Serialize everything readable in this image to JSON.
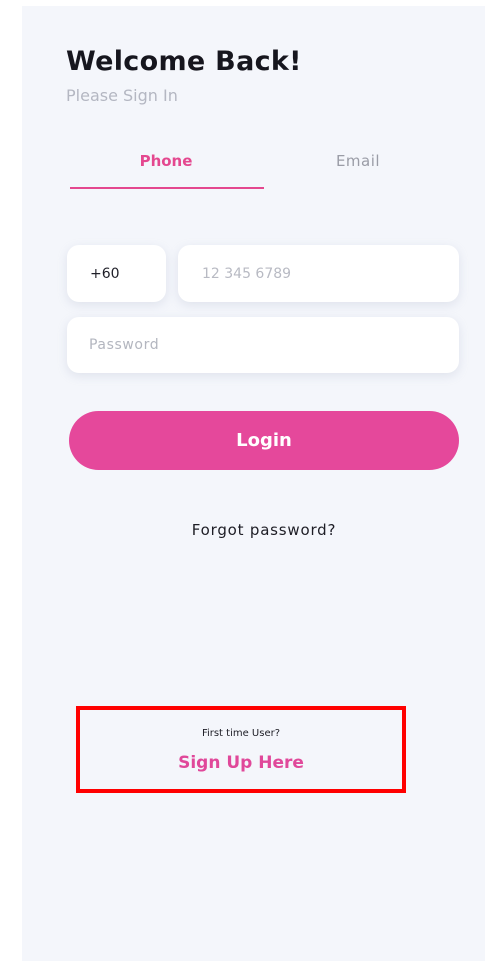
{
  "header": {
    "title": "Welcome Back!",
    "subtitle": "Please Sign In"
  },
  "tabs": [
    {
      "label": "Phone",
      "active": true
    },
    {
      "label": "Email",
      "active": false
    }
  ],
  "form": {
    "country_code": "+60",
    "phone_placeholder": "12 345 6789",
    "password_placeholder": "Password"
  },
  "actions": {
    "login_label": "Login",
    "forgot_password_label": "Forgot password?"
  },
  "signup": {
    "prompt": "First time User?",
    "link_label": "Sign Up Here"
  },
  "colors": {
    "accent": "#e5489b",
    "background": "#f4f6fb",
    "highlight_box": "#ff0000"
  }
}
